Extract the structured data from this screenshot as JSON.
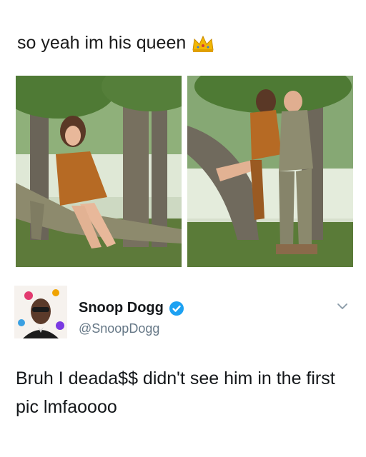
{
  "post": {
    "caption": "so yeah im his queen",
    "caption_emoji": "crown-icon"
  },
  "photos": [
    {
      "name": "photo-woman-posing-on-camouflaged-soldier"
    },
    {
      "name": "photo-soldier-holding-woman"
    }
  ],
  "tweet": {
    "author_name": "Snoop Dogg",
    "verified": true,
    "handle": "@SnoopDogg",
    "text": "Bruh I deada$$ didn't see him in the first pic lmfaoooo",
    "menu_icon": "chevron-down-icon"
  },
  "colors": {
    "verified_blue": "#1da1f2",
    "handle_gray": "#657786",
    "crown_gold": "#f2b705"
  }
}
